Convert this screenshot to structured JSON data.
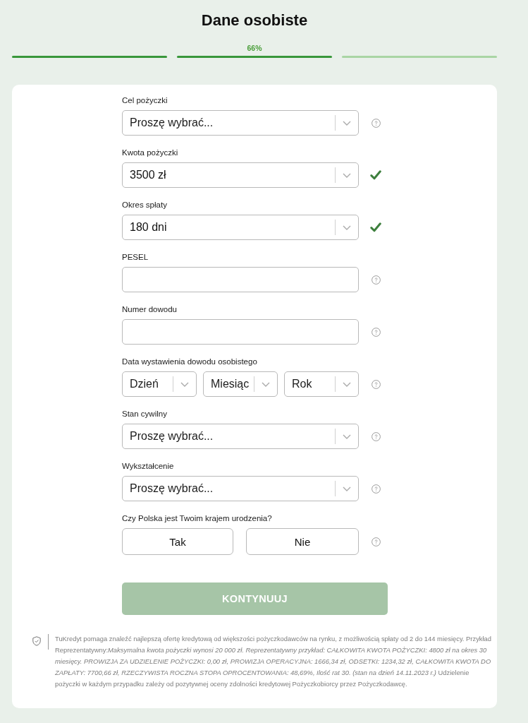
{
  "title": "Dane osobiste",
  "progress": {
    "label": "66%",
    "steps": [
      {
        "done": true
      },
      {
        "done": true
      },
      {
        "done": false
      }
    ]
  },
  "fields": [
    {
      "kind": "select",
      "label": "Cel pożyczki",
      "placeholder": "Proszę wybrać...",
      "valid": false
    },
    {
      "kind": "select",
      "label": "Kwota pożyczki",
      "value": "3500 zł",
      "valid": true
    },
    {
      "kind": "select",
      "label": "Okres spłaty",
      "value": "180 dni",
      "valid": true
    },
    {
      "kind": "input",
      "label": "PESEL",
      "valid": false
    },
    {
      "kind": "input",
      "label": "Numer dowodu",
      "valid": false
    },
    {
      "kind": "date",
      "label": "Data wystawienia dowodu osobistego",
      "parts": [
        {
          "placeholder": "Dzień"
        },
        {
          "placeholder": "Miesiąc"
        },
        {
          "placeholder": "Rok"
        }
      ],
      "valid": false
    },
    {
      "kind": "select",
      "label": "Stan cywilny",
      "placeholder": "Proszę wybrać...",
      "valid": false
    },
    {
      "kind": "select",
      "label": "Wykształcenie",
      "placeholder": "Proszę wybrać...",
      "valid": false
    },
    {
      "kind": "choice",
      "label": "Czy Polska jest Twoim krajem urodzenia?",
      "options": [
        {
          "label": "Tak",
          "selected": false
        },
        {
          "label": "Nie",
          "selected": false
        }
      ],
      "valid": false
    }
  ],
  "submit": {
    "label": "KONTYNUUJ",
    "disabled": true
  },
  "disclaimer": "TuKredyt pomaga znaleźć najlepszą ofertę kredytową od większości pożyczkodawców na rynku, z możliwością spłaty od 2 do 144 miesięcy. Przykład Reprezentatywny:*Maksymalna kwota pożyczki wynosi 20 000 zł. Reprezentatywny przykład: CAŁKOWITA KWOTA POŻYCZKI: 4800 zł na okres 30 miesięcy. PROWIZJA ZA UDZIELENIE POŻYCZKI: 0,00 zł, PROWIZJA OPERACYJNA: 1666,34 zł, ODSETKI: 1234,32 zł, CAŁKOWITA KWOTA DO ZAPŁATY: 7700,66 zł, RZECZYWISTA ROCZNA STOPA OPROCENTOWANIA: 48,69%, Ilość rat 30. (stan na dzień 14.11.2023 r.)* Udzielenie pożyczki w każdym przypadku zależy od pozytywnej oceny zdolności kredytowej Pożyczkobiorcy przez Pożyczkodawcę."
}
